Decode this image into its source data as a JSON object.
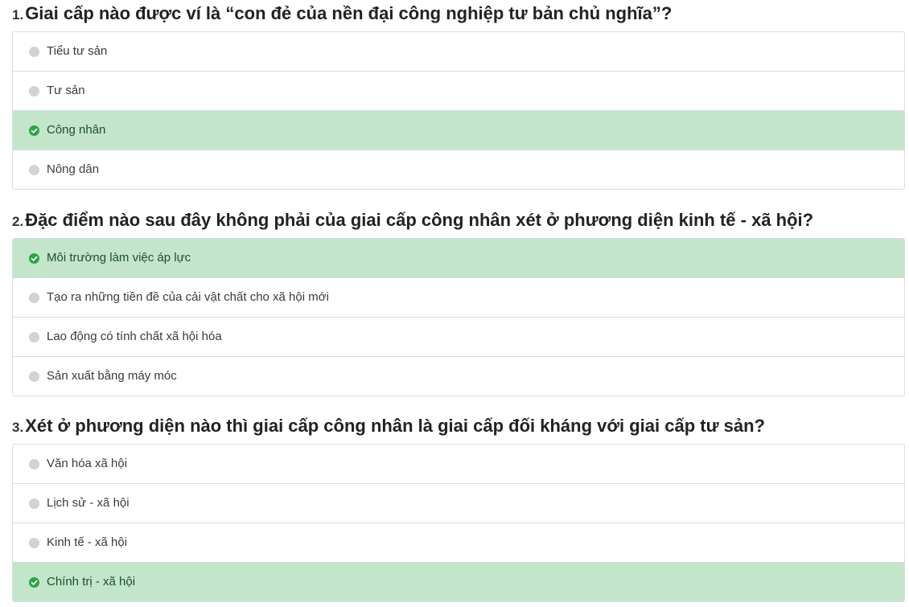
{
  "colors": {
    "correct_bg": "#c3e6cb",
    "correct_icon": "#28a745",
    "radio": "#cfd3d7",
    "border": "#dcdcdc"
  },
  "questions": [
    {
      "number": "1.",
      "text": "Giai cấp nào được ví là “con đẻ của nền đại công nghiệp tư bản chủ nghĩa”?",
      "answers": [
        {
          "label": "Tiểu tư sản",
          "correct": false
        },
        {
          "label": "Tư sản",
          "correct": false
        },
        {
          "label": "Công nhân",
          "correct": true
        },
        {
          "label": "Nông dân",
          "correct": false
        }
      ]
    },
    {
      "number": "2.",
      "text": "Đặc điểm nào sau đây không phải của giai cấp công nhân xét ở phương diện kinh tế - xã hội?",
      "answers": [
        {
          "label": "Môi trường làm việc áp lực",
          "correct": true
        },
        {
          "label": "Tạo ra những tiền đề của cải vật chất cho xã hội mới",
          "correct": false
        },
        {
          "label": "Lao động có tính chất xã hội hóa",
          "correct": false
        },
        {
          "label": "Sản xuất bằng máy móc",
          "correct": false
        }
      ]
    },
    {
      "number": "3.",
      "text": "Xét ở phương diện nào thì giai cấp công nhân là giai cấp đối kháng với giai cấp tư sản?",
      "answers": [
        {
          "label": "Văn hóa xã hội",
          "correct": false
        },
        {
          "label": "Lịch sử - xã hội",
          "correct": false
        },
        {
          "label": "Kinh tế - xã hội",
          "correct": false
        },
        {
          "label": "Chính trị - xã hội",
          "correct": true
        }
      ]
    }
  ],
  "icons": {
    "correct": "check-circle-icon",
    "unselected": "radio-circle-icon"
  }
}
